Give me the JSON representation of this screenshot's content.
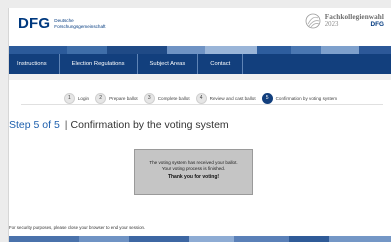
{
  "brand": {
    "logo_mark": "DFG",
    "logo_line1": "Deutsche",
    "logo_line2": "Forschungsgemeinschaft",
    "election_title": "Fachkollegienwahl",
    "election_year": "2023",
    "election_org": "DFG"
  },
  "nav": {
    "items": [
      {
        "label": "Instructions"
      },
      {
        "label": "Election Regulations"
      },
      {
        "label": "Subject Areas"
      },
      {
        "label": "Contact"
      }
    ]
  },
  "steps": [
    {
      "num": "1",
      "label": "Login",
      "active": false
    },
    {
      "num": "2",
      "label": "Prepare ballot",
      "active": false
    },
    {
      "num": "3",
      "label": "Complete ballot",
      "active": false
    },
    {
      "num": "4",
      "label": "Review and cast ballot",
      "active": false
    },
    {
      "num": "5",
      "label": "Confirmation by voting system",
      "active": true
    }
  ],
  "main": {
    "step_of": "Step 5 of 5",
    "separator": "|",
    "title": "Confirmation by the voting system",
    "message_line1": "The voting system has received your ballot.",
    "message_line2": "Your voting process is finished.",
    "thanks": "Thank you for voting!",
    "security_note": "For security purposes, please close your browser to end your session."
  },
  "colors": {
    "nav_bg": "#123f7d",
    "accent_blue": "#1d5fad",
    "message_box_bg": "#c5c5c5"
  }
}
